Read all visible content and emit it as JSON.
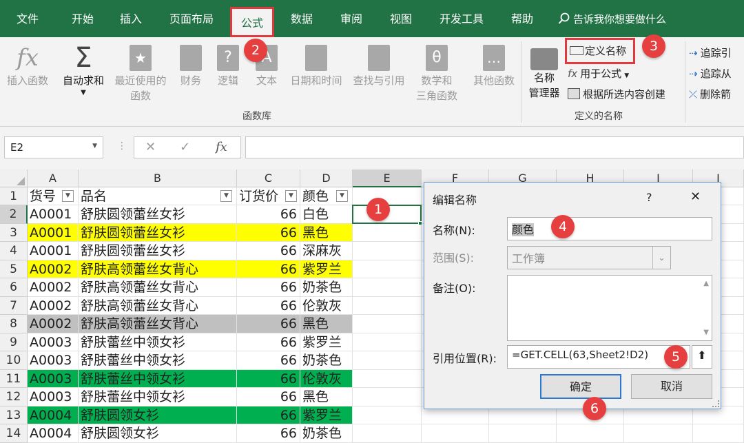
{
  "menu": {
    "tabs": [
      "文件",
      "开始",
      "插入",
      "页面布局",
      "公式",
      "数据",
      "审阅",
      "视图",
      "开发工具",
      "帮助"
    ],
    "active": "公式",
    "tell_me": "告诉我你想要做什么"
  },
  "ribbon": {
    "insert_function": "插入函数",
    "autosum": "自动求和",
    "recent": [
      "最近使用的",
      "函数"
    ],
    "financial": "财务",
    "logical": "逻辑",
    "text": "文本",
    "datetime": "日期和时间",
    "lookup": "查找与引用",
    "math": [
      "数学和",
      "三角函数"
    ],
    "more": "其他函数",
    "group_function_library": "函数库",
    "name_manager": [
      "名称",
      "管理器"
    ],
    "define_name": "定义名称",
    "use_in_formula": "用于公式",
    "create_from_selection": "根据所选内容创建",
    "group_defined_names": "定义的名称",
    "trace_precedents": "追踪引",
    "trace_dependents": "追踪从",
    "remove_arrows": "删除箭"
  },
  "formula_bar": {
    "name_box": "E2",
    "fx": "fx"
  },
  "sheet": {
    "columns": [
      "A",
      "B",
      "C",
      "D",
      "E",
      "F",
      "G",
      "H",
      "I",
      "J"
    ],
    "headers": [
      "货号",
      "品名",
      "订货价",
      "颜色"
    ],
    "rows": [
      {
        "num": "2",
        "a": "A0001",
        "b": "舒肤圆领蕾丝女衫",
        "c": "66",
        "d": "白色",
        "fill": "#ffffff"
      },
      {
        "num": "3",
        "a": "A0001",
        "b": "舒肤圆领蕾丝女衫",
        "c": "66",
        "d": "黑色",
        "fill": "#ffff00"
      },
      {
        "num": "4",
        "a": "A0001",
        "b": "舒肤圆领蕾丝女衫",
        "c": "66",
        "d": "深麻灰",
        "fill": "#ffffff"
      },
      {
        "num": "5",
        "a": "A0002",
        "b": "舒肤高领蕾丝女背心",
        "c": "66",
        "d": "紫罗兰",
        "fill": "#ffff00"
      },
      {
        "num": "6",
        "a": "A0002",
        "b": "舒肤高领蕾丝女背心",
        "c": "66",
        "d": "奶茶色",
        "fill": "#ffffff"
      },
      {
        "num": "7",
        "a": "A0002",
        "b": "舒肤高领蕾丝女背心",
        "c": "66",
        "d": "伦敦灰",
        "fill": "#ffffff"
      },
      {
        "num": "8",
        "a": "A0002",
        "b": "舒肤高领蕾丝女背心",
        "c": "66",
        "d": "黑色",
        "fill": "#c0c0c0"
      },
      {
        "num": "9",
        "a": "A0003",
        "b": "舒肤蕾丝中领女衫",
        "c": "66",
        "d": "紫罗兰",
        "fill": "#ffffff"
      },
      {
        "num": "10",
        "a": "A0003",
        "b": "舒肤蕾丝中领女衫",
        "c": "66",
        "d": "奶茶色",
        "fill": "#ffffff"
      },
      {
        "num": "11",
        "a": "A0003",
        "b": "舒肤蕾丝中领女衫",
        "c": "66",
        "d": "伦敦灰",
        "fill": "#00b050"
      },
      {
        "num": "12",
        "a": "A0003",
        "b": "舒肤蕾丝中领女衫",
        "c": "66",
        "d": "黑色",
        "fill": "#ffffff"
      },
      {
        "num": "13",
        "a": "A0004",
        "b": "舒肤圆领女衫",
        "c": "66",
        "d": "紫罗兰",
        "fill": "#00b050"
      },
      {
        "num": "14",
        "a": "A0004",
        "b": "舒肤圆领女衫",
        "c": "66",
        "d": "奶茶色",
        "fill": "#ffffff"
      }
    ]
  },
  "dialog": {
    "title": "编辑名称",
    "help": "?",
    "close": "✕",
    "name_label": "名称(N):",
    "name_value": "颜色",
    "scope_label": "范围(S):",
    "scope_value": "工作簿",
    "comment_label": "备注(O):",
    "ref_label": "引用位置(R):",
    "ref_value": "=GET.CELL(63,Sheet2!D2)",
    "ok": "确定",
    "cancel": "取消"
  },
  "badges": [
    "1",
    "2",
    "3",
    "4",
    "5",
    "6"
  ],
  "colors": {
    "excel_green": "#217346",
    "badge_red": "#e63f3f",
    "highlight_yellow": "#ffff00",
    "highlight_green": "#00b050",
    "highlight_gray": "#c0c0c0"
  }
}
